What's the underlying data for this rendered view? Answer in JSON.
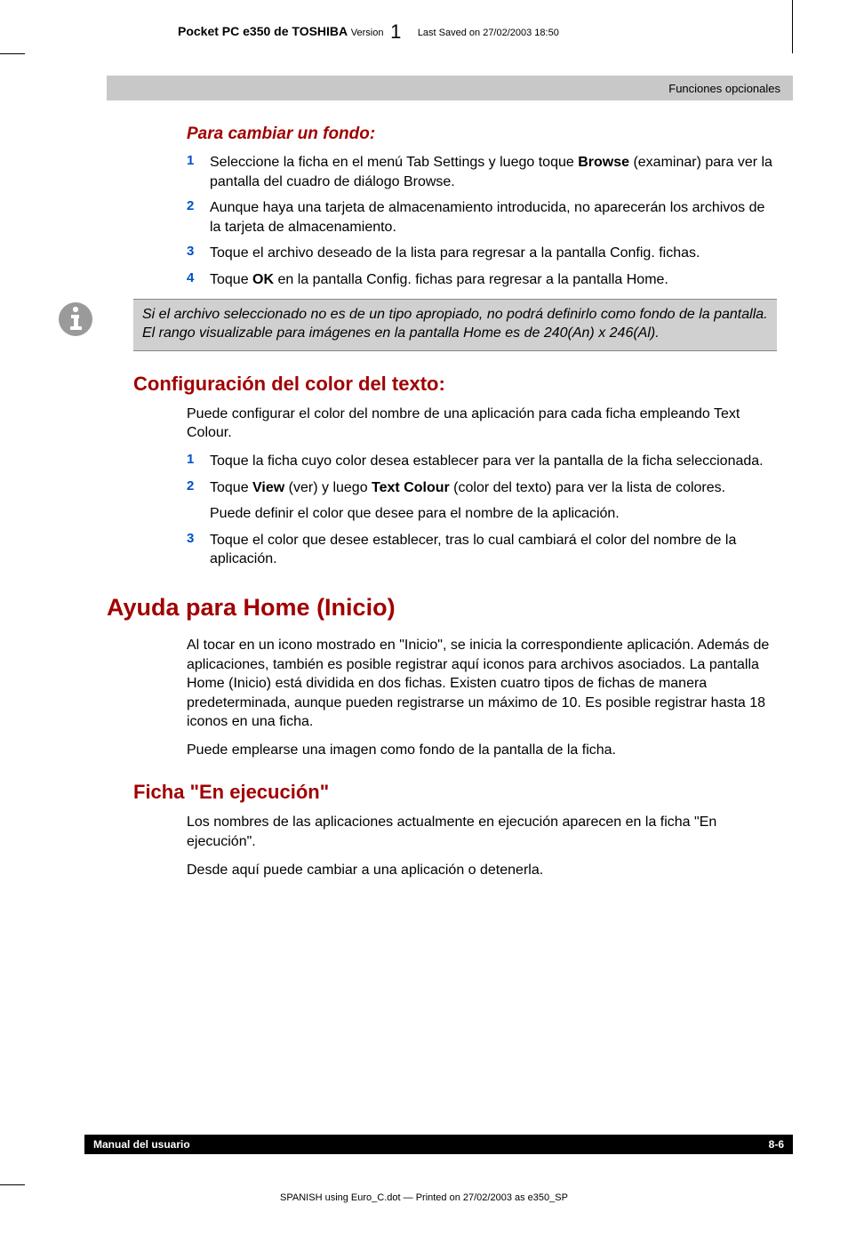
{
  "header": {
    "title": "Pocket PC e350 de TOSHIBA",
    "version_label": "Version",
    "version_num": "1",
    "saved": "Last Saved on 27/02/2003 18:50"
  },
  "banner": "Funciones opcionales",
  "section1": {
    "title": "Para cambiar un fondo:",
    "items": [
      {
        "num": "1",
        "pre": "Seleccione la ficha en el menú Tab Settings y luego toque ",
        "bold": "Browse",
        "post": " (examinar) para ver la pantalla del cuadro de diálogo Browse."
      },
      {
        "num": "2",
        "text": "Aunque haya una tarjeta de almacenamiento introducida, no aparecerán los archivos de la tarjeta de almacenamiento."
      },
      {
        "num": "3",
        "text": "Toque el archivo deseado de la lista para regresar a la pantalla Config. fichas."
      },
      {
        "num": "4",
        "pre": "Toque ",
        "bold": "OK",
        "post": " en la pantalla Config. fichas para regresar a la pantalla Home."
      }
    ]
  },
  "note": "Si el archivo seleccionado no es de un tipo apropiado, no podrá definirlo como fondo de la pantalla. El rango visualizable para imágenes en la pantalla Home es de 240(An) x 246(Al).",
  "section2": {
    "title": "Configuración del color del texto:",
    "intro": "Puede configurar el color del nombre de una aplicación para cada ficha empleando Text Colour.",
    "items": [
      {
        "num": "1",
        "text": "Toque la ficha cuyo color desea establecer para ver la pantalla de la ficha seleccionada."
      },
      {
        "num": "2",
        "pre": "Toque ",
        "bold": "View",
        "mid": " (ver) y luego ",
        "bold2": "Text Colour",
        "post": " (color del texto) para ver la lista de colores.",
        "sub": "Puede definir el color que desee para el nombre de la aplicación."
      },
      {
        "num": "3",
        "text": "Toque el color que desee establecer, tras lo cual cambiará el color del nombre de la aplicación."
      }
    ]
  },
  "section3": {
    "title": "Ayuda para Home (Inicio)",
    "p1": "Al tocar en un icono mostrado en \"Inicio\", se inicia la correspondiente aplicación. Además de aplicaciones, también es posible registrar aquí iconos para archivos asociados. La pantalla Home (Inicio) está dividida en dos fichas. Existen cuatro tipos de fichas de manera predeterminada, aunque pueden registrarse un máximo de 10. Es posible registrar hasta 18 iconos en una ficha.",
    "p2": "Puede emplearse una imagen como fondo de la pantalla de la ficha."
  },
  "section4": {
    "title": "Ficha \"En ejecución\"",
    "p1": "Los nombres de las aplicaciones actualmente en ejecución aparecen en la ficha \"En ejecución\".",
    "p2": "Desde aquí puede cambiar a una aplicación o detenerla."
  },
  "footer": {
    "left": "Manual del usuario",
    "right": "8-6",
    "print": "SPANISH using  Euro_C.dot — Printed on 27/02/2003 as e350_SP"
  }
}
